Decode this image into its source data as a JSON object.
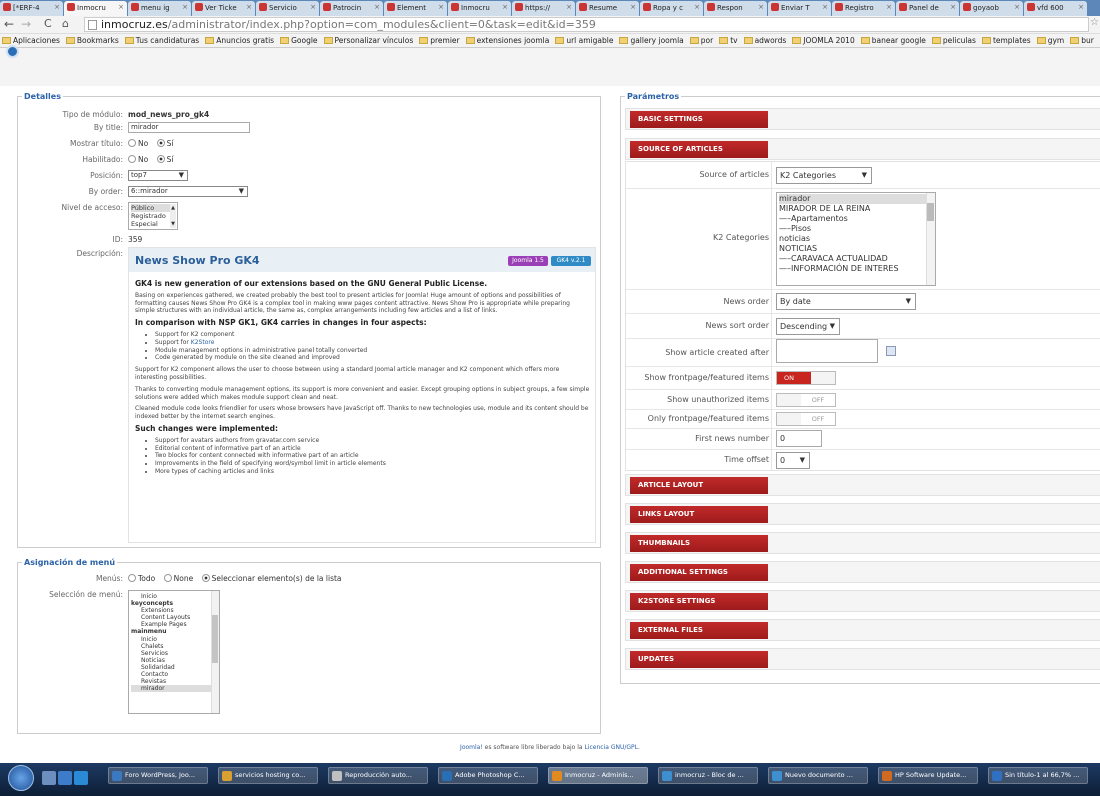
{
  "browser": {
    "tabs": [
      {
        "label": "[*ERF-4",
        "active": false
      },
      {
        "label": "Inmocru",
        "active": true
      },
      {
        "label": "menu ig",
        "active": false
      },
      {
        "label": "Ver Ticke",
        "active": false
      },
      {
        "label": "Servicio",
        "active": false
      },
      {
        "label": "Patrocin",
        "active": false
      },
      {
        "label": "Element",
        "active": false
      },
      {
        "label": "Inmocru",
        "active": false
      },
      {
        "label": "https://",
        "active": false
      },
      {
        "label": "Resume",
        "active": false
      },
      {
        "label": "Ropa y c",
        "active": false
      },
      {
        "label": "Respon",
        "active": false
      },
      {
        "label": "Enviar T",
        "active": false
      },
      {
        "label": "Registro",
        "active": false
      },
      {
        "label": "Panel de",
        "active": false
      },
      {
        "label": "goyaob",
        "active": false
      },
      {
        "label": "vfd 600",
        "active": false
      }
    ],
    "url_domain": "inmocruz.es",
    "url_path": "/administrator/index.php?option=com_modules&client=0&task=edit&id=359",
    "bookmarks": [
      "Aplicaciones",
      "Bookmarks",
      "Tus candidaturas",
      "Anuncios gratis",
      "Google",
      "Personalizar vínculos",
      "premier",
      "extensiones joomla",
      "url amigable",
      "gallery joomla",
      "por",
      "tv",
      "adwords",
      "JOOMLA 2010",
      "banear google",
      "peliculas",
      "templates",
      "gym",
      "bur"
    ]
  },
  "detalles": {
    "legend": "Detalles",
    "tipo_label": "Tipo de módulo:",
    "tipo_value": "mod_news_pro_gk4",
    "bytitle_label": "By title:",
    "bytitle_value": "mirador",
    "mostrar_label": "Mostrar título:",
    "habilitado_label": "Habilitado:",
    "no": "No",
    "si": "Sí",
    "posicion_label": "Posición:",
    "posicion_value": "top7",
    "byorder_label": "By order:",
    "byorder_value": "6::mirador",
    "nivel_label": "Nivel de acceso:",
    "nivel_options": [
      "Público",
      "Registrado",
      "Especial"
    ],
    "id_label": "ID:",
    "id_value": "359",
    "descripcion_label": "Descripción:"
  },
  "description": {
    "title": "News Show Pro GK4",
    "badge1": "Joomla 1.5",
    "badge2": "GK4 v.2.1",
    "badge1_color": "#9b3fb6",
    "badge2_color": "#2e8bc6",
    "h1": "GK4 is new generation of our extensions based on the GNU General Public License.",
    "p1": "Basing on experiences gathered, we created probably the best tool to present articles for Joomla! Huge amount of options and possibilities of formatting causes News Show Pro GK4 is a complex tool in making www pages content attractive. News Show Pro is appropriate while preparing simple structures with an individual article, the same as, complex arrangements including few articles and a list of links.",
    "h2": "In comparison with NSP GK1, GK4 carries in changes in four aspects:",
    "list1_a": "Support for K2 component",
    "list1_b_prefix": "Support for ",
    "list1_b_link": "K2Store",
    "list1_c": "Module management options in administrative panel totally converted",
    "list1_d": "Code generated by module on the site cleaned and improved",
    "p2": "Support for K2 component allows the user to choose between using a standard Joomal article manager and K2 component which offers more interesting possibilities.",
    "p3": "Thanks to converting module management options, its support is more convenient and easier. Except grouping options in subject groups, a few simple solutions were added which makes module support clean and neat.",
    "p4": "Cleaned module code looks friendlier for users whose browsers have JavaScript off. Thanks to new technologies use, module and its content should be indexed better by the internet search engines.",
    "h3": "Such changes were implemented:",
    "list2": [
      "Support for avatars authors from gravatar.com service",
      "Editorial content of informative part of an article",
      "Two blocks for content connected with informative part of an article",
      "Improvements in the field of specifying word/symbol limit in article elements",
      "More types of caching articles and links"
    ]
  },
  "asignacion": {
    "legend": "Asignación de menú",
    "menus_label": "Menús:",
    "todo": "Todo",
    "none": "None",
    "seleccionar": "Seleccionar elemento(s) de la lista",
    "seleccion_label": "Selección de menú:",
    "items": [
      {
        "text": "Inicio",
        "type": "i"
      },
      {
        "text": "keyconcepts",
        "type": "g"
      },
      {
        "text": "Extensions",
        "type": "i"
      },
      {
        "text": "Content Layouts",
        "type": "i"
      },
      {
        "text": "Example Pages",
        "type": "i"
      },
      {
        "text": "mainmenu",
        "type": "g"
      },
      {
        "text": "Inicio",
        "type": "i"
      },
      {
        "text": "Chalets",
        "type": "i"
      },
      {
        "text": "Servicios",
        "type": "i"
      },
      {
        "text": "Noticias",
        "type": "i"
      },
      {
        "text": "Solidaridad",
        "type": "i"
      },
      {
        "text": "Contacto",
        "type": "i"
      },
      {
        "text": "Revistas",
        "type": "i"
      },
      {
        "text": "mirador",
        "type": "sel"
      }
    ]
  },
  "parametros": {
    "legend": "Parámetros",
    "basic": "BASIC SETTINGS",
    "source_section": "SOURCE OF ARTICLES",
    "source_label": "Source of articles",
    "source_value": "K2 Categories",
    "k2cat_label": "K2 Categories",
    "k2cats": [
      "mirador",
      "MIRADOR DE LA REINA",
      "—–Apartamentos",
      "—–Pisos",
      "noticias",
      "NOTICIAS",
      "—–CARAVACA ACTUALIDAD",
      "—–INFORMACIÓN DE INTERES"
    ],
    "news_order_label": "News order",
    "news_order_value": "By date",
    "sort_order_label": "News sort order",
    "sort_order_value": "Descending",
    "created_after_label": "Show article created after",
    "frontpage_label": "Show frontpage/featured items",
    "unauth_label": "Show unauthorized items",
    "only_frontpage_label": "Only frontpage/featured items",
    "on": "ON",
    "off": "OFF",
    "first_news_label": "First news number",
    "first_news_value": "0",
    "time_offset_label": "Time offset",
    "time_offset_value": "0",
    "sections": [
      "ARTICLE LAYOUT",
      "LINKS LAYOUT",
      "THUMBNAILS",
      "ADDITIONAL SETTINGS",
      "K2STORE SETTINGS",
      "EXTERNAL FILES",
      "UPDATES"
    ],
    "accent": "#b62222"
  },
  "footer": {
    "link1": "Joomla!",
    "mid": " es software libre liberado bajo la ",
    "link2": "Licencia GNU/GPL",
    "end": "."
  },
  "taskbar": {
    "items": [
      "Foro WordPress, Joo...",
      "servicios hosting co...",
      "Reproducción auto...",
      "Adobe Photoshop C...",
      "Inmocruz - Adminis...",
      "inmocruz - Bloc de ...",
      "Nuevo documento ...",
      "HP Software Update...",
      "Sin título-1 al 66,7% ..."
    ]
  }
}
